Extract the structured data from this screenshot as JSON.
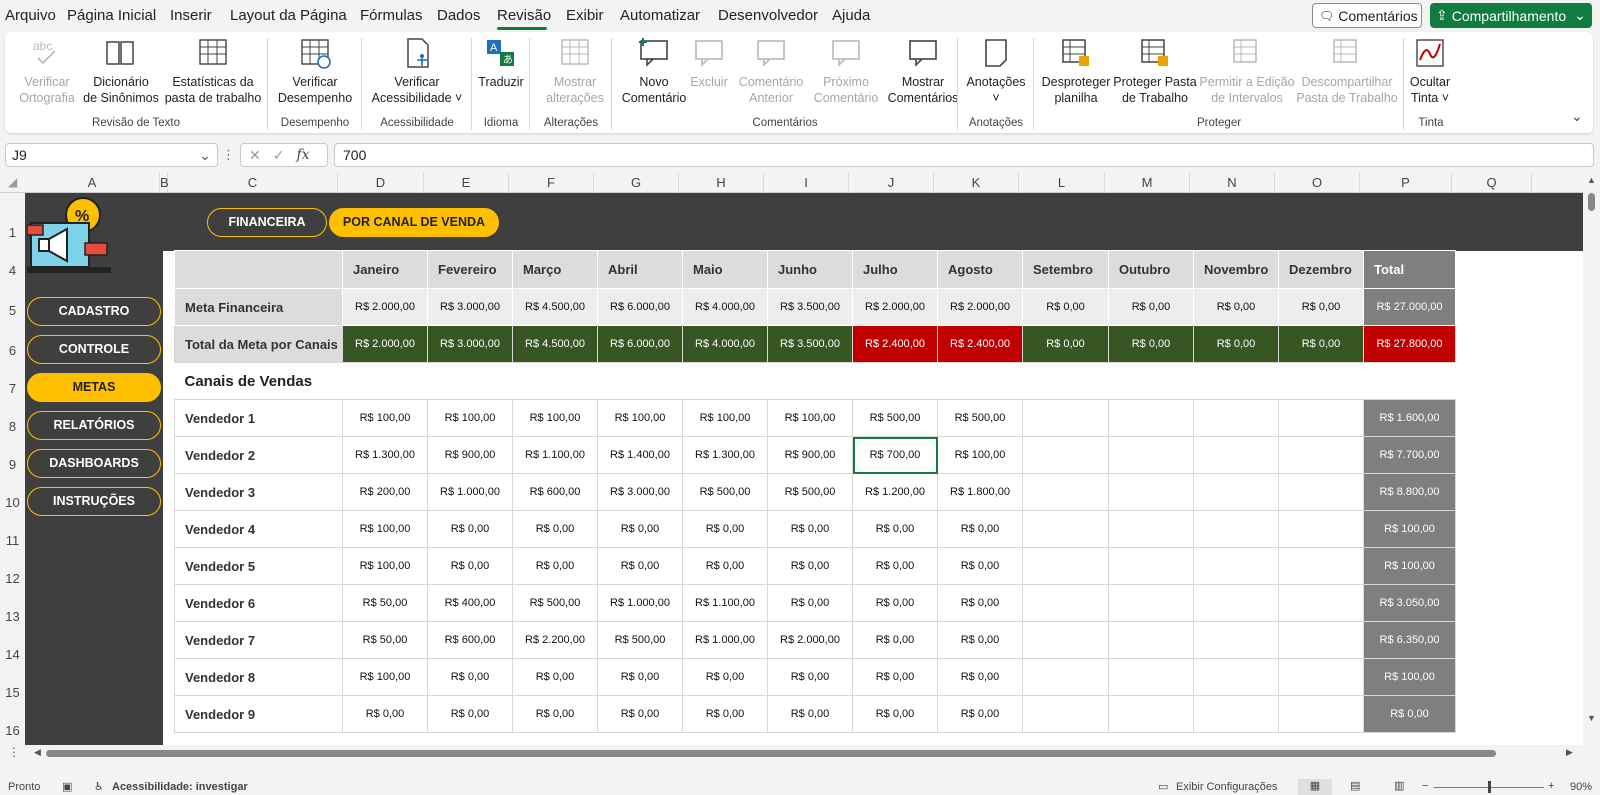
{
  "menu": {
    "tabs": [
      "Arquivo",
      "Página Inicial",
      "Inserir",
      "Layout da Página",
      "Fórmulas",
      "Dados",
      "Revisão",
      "Exibir",
      "Automatizar",
      "Desenvolvedor",
      "Ajuda"
    ],
    "active_tab": "Revisão",
    "comments_label": "Comentários",
    "share_label": "Compartilhamento",
    "accent_color": "#107c41"
  },
  "ribbon": {
    "buttons": [
      {
        "line1": "Verificar",
        "line2": "Ortografia",
        "icon": "spellcheck-icon",
        "disabled": true
      },
      {
        "line1": "Dicionário",
        "line2": "de Sinônimos",
        "icon": "thesaurus-icon",
        "disabled": false
      },
      {
        "line1": "Estatísticas da",
        "line2": "pasta de trabalho",
        "icon": "workbook-stats-icon",
        "disabled": false
      },
      {
        "line1": "Verificar",
        "line2": "Desempenho",
        "icon": "performance-icon",
        "disabled": false
      },
      {
        "line1": "Verificar",
        "line2": "Acessibilidade ˅",
        "icon": "accessibility-icon",
        "disabled": false
      },
      {
        "line1": "Traduzir",
        "line2": "",
        "icon": "translate-icon",
        "disabled": false
      },
      {
        "line1": "Mostrar",
        "line2": "alterações",
        "icon": "show-changes-icon",
        "disabled": true
      },
      {
        "line1": "Novo",
        "line2": "Comentário",
        "icon": "new-comment-icon",
        "disabled": false
      },
      {
        "line1": "Excluir",
        "line2": "",
        "icon": "delete-comment-icon",
        "disabled": true
      },
      {
        "line1": "Comentário",
        "line2": "Anterior",
        "icon": "previous-comment-icon",
        "disabled": true
      },
      {
        "line1": "Próximo",
        "line2": "Comentário",
        "icon": "next-comment-icon",
        "disabled": true
      },
      {
        "line1": "Mostrar",
        "line2": "Comentários",
        "icon": "show-comments-icon",
        "disabled": false
      },
      {
        "line1": "Anotações",
        "line2": "˅",
        "icon": "notes-icon",
        "disabled": false
      },
      {
        "line1": "Desproteger",
        "line2": "planilha",
        "icon": "unprotect-sheet-icon",
        "disabled": false
      },
      {
        "line1": "Proteger Pasta",
        "line2": "de Trabalho",
        "icon": "protect-workbook-icon",
        "disabled": false
      },
      {
        "line1": "Permitir a Edição",
        "line2": "de Intervalos",
        "icon": "allow-edit-ranges-icon",
        "disabled": true
      },
      {
        "line1": "Descompartilhar",
        "line2": "Pasta de Trabalho",
        "icon": "unshare-workbook-icon",
        "disabled": true
      },
      {
        "line1": "Ocultar",
        "line2": "Tinta ˅",
        "icon": "hide-ink-icon",
        "disabled": false
      }
    ],
    "groups": [
      "Revisão de Texto",
      "Desempenho",
      "Acessibilidade",
      "Idioma",
      "Alterações",
      "Comentários",
      "Anotações",
      "Proteger",
      "Tinta"
    ]
  },
  "formula_bar": {
    "name_box": "J9",
    "formula": "700"
  },
  "columns": [
    "A",
    "B",
    "C",
    "D",
    "E",
    "F",
    "G",
    "H",
    "I",
    "J",
    "K",
    "L",
    "M",
    "N",
    "O",
    "P",
    "Q"
  ],
  "rows": [
    "1",
    "4",
    "5",
    "6",
    "7",
    "8",
    "9",
    "10",
    "11",
    "12",
    "13",
    "14",
    "15",
    "16"
  ],
  "sheet": {
    "top_buttons": [
      "FINANCEIRA",
      "POR CANAL DE VENDA"
    ],
    "nav": [
      "CADASTRO",
      "CONTROLE",
      "METAS",
      "RELATÓRIOS",
      "DASHBOARDS",
      "INSTRUÇÕES"
    ],
    "active_nav": "METAS",
    "months": [
      "Janeiro",
      "Fevereiro",
      "Março",
      "Abril",
      "Maio",
      "Junho",
      "Julho",
      "Agosto",
      "Setembro",
      "Outubro",
      "Novembro",
      "Dezembro"
    ],
    "total_label": "Total",
    "meta_row": {
      "label": "Meta Financeira",
      "values": [
        "R$ 2.000,00",
        "R$ 3.000,00",
        "R$ 4.500,00",
        "R$ 6.000,00",
        "R$ 4.000,00",
        "R$ 3.500,00",
        "R$ 2.000,00",
        "R$ 2.000,00",
        "R$ 0,00",
        "R$ 0,00",
        "R$ 0,00",
        "R$ 0,00"
      ],
      "total": "R$ 27.000,00"
    },
    "canais_row": {
      "label": "Total da Meta por Canais",
      "values": [
        "R$ 2.000,00",
        "R$ 3.000,00",
        "R$ 4.500,00",
        "R$ 6.000,00",
        "R$ 4.000,00",
        "R$ 3.500,00",
        "R$ 2.400,00",
        "R$ 2.400,00",
        "R$ 0,00",
        "R$ 0,00",
        "R$ 0,00",
        "R$ 0,00"
      ],
      "over": [
        false,
        false,
        false,
        false,
        false,
        false,
        true,
        true,
        false,
        false,
        false,
        false
      ],
      "total": "R$ 27.800,00"
    },
    "section_title": "Canais de Vendas",
    "sellers": [
      {
        "name": "Vendedor 1",
        "values": [
          "R$ 100,00",
          "R$ 100,00",
          "R$ 100,00",
          "R$ 100,00",
          "R$ 100,00",
          "R$ 100,00",
          "R$ 500,00",
          "R$ 500,00",
          "",
          "",
          "",
          ""
        ],
        "total": "R$ 1.600,00"
      },
      {
        "name": "Vendedor 2",
        "values": [
          "R$ 1.300,00",
          "R$ 900,00",
          "R$ 1.100,00",
          "R$ 1.400,00",
          "R$ 1.300,00",
          "R$ 900,00",
          "R$ 700,00",
          "R$ 100,00",
          "",
          "",
          "",
          ""
        ],
        "total": "R$ 7.700,00"
      },
      {
        "name": "Vendedor 3",
        "values": [
          "R$ 200,00",
          "R$ 1.000,00",
          "R$ 600,00",
          "R$ 3.000,00",
          "R$ 500,00",
          "R$ 500,00",
          "R$ 1.200,00",
          "R$ 1.800,00",
          "",
          "",
          "",
          ""
        ],
        "total": "R$ 8.800,00"
      },
      {
        "name": "Vendedor 4",
        "values": [
          "R$ 100,00",
          "R$ 0,00",
          "R$ 0,00",
          "R$ 0,00",
          "R$ 0,00",
          "R$ 0,00",
          "R$ 0,00",
          "R$ 0,00",
          "",
          "",
          "",
          ""
        ],
        "total": "R$ 100,00"
      },
      {
        "name": "Vendedor 5",
        "values": [
          "R$ 100,00",
          "R$ 0,00",
          "R$ 0,00",
          "R$ 0,00",
          "R$ 0,00",
          "R$ 0,00",
          "R$ 0,00",
          "R$ 0,00",
          "",
          "",
          "",
          ""
        ],
        "total": "R$ 100,00"
      },
      {
        "name": "Vendedor 6",
        "values": [
          "R$ 50,00",
          "R$ 400,00",
          "R$ 500,00",
          "R$ 1.000,00",
          "R$ 1.100,00",
          "R$ 0,00",
          "R$ 0,00",
          "R$ 0,00",
          "",
          "",
          "",
          ""
        ],
        "total": "R$ 3.050,00"
      },
      {
        "name": "Vendedor 7",
        "values": [
          "R$ 50,00",
          "R$ 600,00",
          "R$ 2.200,00",
          "R$ 500,00",
          "R$ 1.000,00",
          "R$ 2.000,00",
          "R$ 0,00",
          "R$ 0,00",
          "",
          "",
          "",
          ""
        ],
        "total": "R$ 6.350,00"
      },
      {
        "name": "Vendedor 8",
        "values": [
          "R$ 100,00",
          "R$ 0,00",
          "R$ 0,00",
          "R$ 0,00",
          "R$ 0,00",
          "R$ 0,00",
          "R$ 0,00",
          "R$ 0,00",
          "",
          "",
          "",
          ""
        ],
        "total": "R$ 100,00"
      },
      {
        "name": "Vendedor 9",
        "values": [
          "R$ 0,00",
          "R$ 0,00",
          "R$ 0,00",
          "R$ 0,00",
          "R$ 0,00",
          "R$ 0,00",
          "R$ 0,00",
          "R$ 0,00",
          "",
          "",
          "",
          ""
        ],
        "total": "R$ 0,00"
      }
    ]
  },
  "status": {
    "ready": "Pronto",
    "accessibility": "Acessibilidade: investigar",
    "display_settings": "Exibir Configurações",
    "zoom": "90%"
  }
}
